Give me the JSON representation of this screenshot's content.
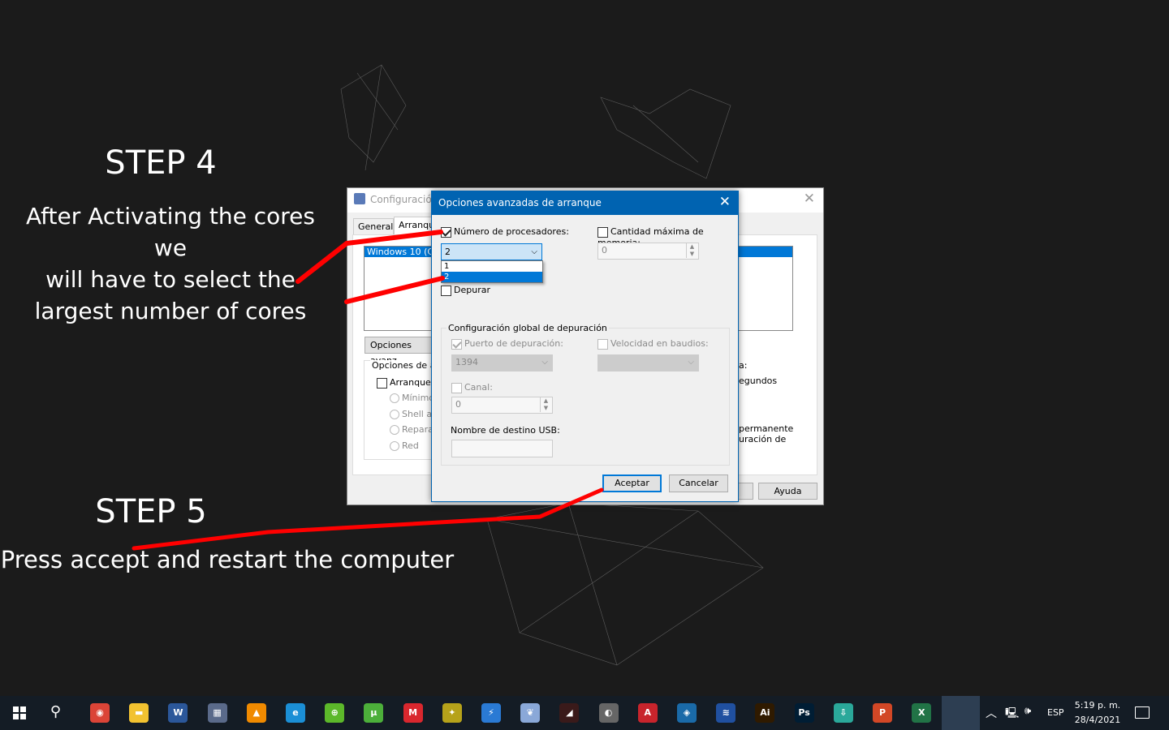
{
  "annotations": {
    "step4_title": "STEP 4",
    "step4_text": [
      "After Activating the cores we",
      "will have to select the",
      "largest number of cores"
    ],
    "step5_title": "STEP 5",
    "step5_text": "Press accept and restart the computer",
    "line_color": "#ff0000"
  },
  "back_window": {
    "title": "Configuración",
    "tabs": [
      "General",
      "Arranque"
    ],
    "list_item": "Windows 10 (C:\\",
    "advanced_button": "Opciones avanz",
    "group_label": "Opciones de arr",
    "safe_boot": "Arranque a",
    "radios": [
      "Mínimo",
      "Shell alt",
      "Reparar",
      "Red"
    ],
    "right_texts": [
      "a:",
      "egundos",
      "permanente",
      "uración de"
    ],
    "help_button": "Ayuda"
  },
  "dialog": {
    "title": "Opciones avanzadas de arranque",
    "num_processors_label": "Número de procesadores:",
    "num_processors_checked": true,
    "num_processors_value": "2",
    "dropdown_options": [
      "1",
      "2"
    ],
    "dropdown_selected": "2",
    "max_memory_label": "Cantidad máxima de memoria:",
    "max_memory_value": "0",
    "debug_label": "Depurar",
    "global_debug_group": "Configuración global de depuración",
    "debug_port_label": "Puerto de depuración:",
    "debug_port_value": "1394",
    "baud_label": "Velocidad en baudios:",
    "channel_label": "Canal:",
    "channel_value": "0",
    "usb_label": "Nombre de destino USB:",
    "accept": "Aceptar",
    "cancel": "Cancelar",
    "accent": "#0063b1"
  },
  "taskbar": {
    "apps": [
      {
        "icon": "chrome-icon",
        "glyph": "◉",
        "color": "#db4437"
      },
      {
        "icon": "file-explorer-icon",
        "glyph": "▬",
        "color": "#f2c230"
      },
      {
        "icon": "word-icon",
        "glyph": "W",
        "color": "#2b579a"
      },
      {
        "icon": "msconfig-icon",
        "glyph": "▦",
        "color": "#5a6a8a"
      },
      {
        "icon": "vlc-icon",
        "glyph": "▲",
        "color": "#f08a00"
      },
      {
        "icon": "edge-icon",
        "glyph": "e",
        "color": "#1b8fd6"
      },
      {
        "icon": "app-green-icon",
        "glyph": "⊕",
        "color": "#5cb82a"
      },
      {
        "icon": "utorrent-icon",
        "glyph": "µ",
        "color": "#4caf3a"
      },
      {
        "icon": "mega-icon",
        "glyph": "M",
        "color": "#d9272e"
      },
      {
        "icon": "app-yellow-icon",
        "glyph": "✦",
        "color": "#b6a21a"
      },
      {
        "icon": "app-blue-bolt-icon",
        "glyph": "⚡",
        "color": "#2a7ad4"
      },
      {
        "icon": "app-feather-icon",
        "glyph": "❦",
        "color": "#8aa8d8"
      },
      {
        "icon": "app-dark-red-icon",
        "glyph": "◢",
        "color": "#3a1a1a"
      },
      {
        "icon": "app-globe-icon",
        "glyph": "◐",
        "color": "#666"
      },
      {
        "icon": "autocad-icon",
        "glyph": "A",
        "color": "#c8242c"
      },
      {
        "icon": "app-cube-icon",
        "glyph": "◈",
        "color": "#1a6aa8"
      },
      {
        "icon": "app-layers-icon",
        "glyph": "≋",
        "color": "#2050a0"
      },
      {
        "icon": "illustrator-icon",
        "glyph": "Ai",
        "color": "#2f1a00"
      },
      {
        "icon": "photoshop-icon",
        "glyph": "Ps",
        "color": "#001d34"
      },
      {
        "icon": "app-download-icon",
        "glyph": "⇩",
        "color": "#2aa89a"
      },
      {
        "icon": "powerpoint-icon",
        "glyph": "P",
        "color": "#d24726"
      },
      {
        "icon": "excel-icon",
        "glyph": "X",
        "color": "#217346"
      },
      {
        "icon": "system-config-icon",
        "glyph": "▣",
        "color": "#3a6ab0"
      }
    ],
    "language": "ESP",
    "time": "5:19 p. m.",
    "date": "28/4/2021"
  }
}
